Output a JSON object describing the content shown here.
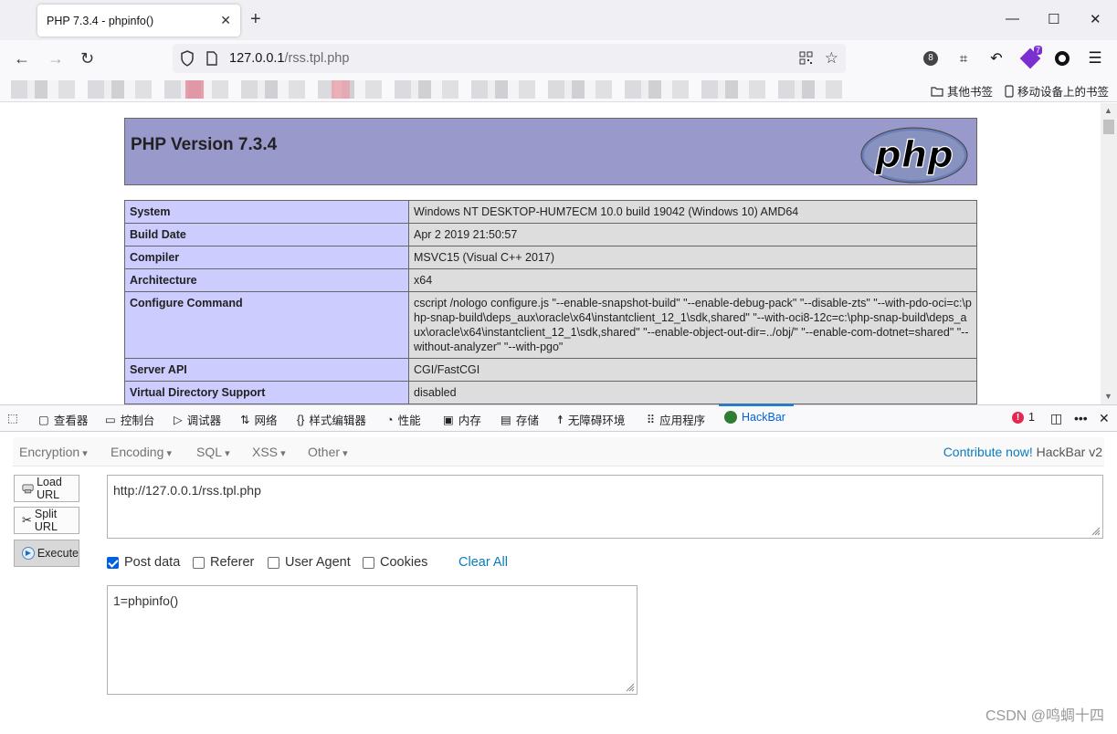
{
  "browser": {
    "tab_title": "PHP 7.3.4 - phpinfo()",
    "url_host": "127.0.0.1",
    "url_path": "/rss.tpl.php",
    "extension_badge": "8",
    "notification_badge": "7",
    "bookmarks": {
      "other": "其他书签",
      "mobile": "移动设备上的书签"
    }
  },
  "phpinfo": {
    "title": "PHP Version 7.3.4",
    "logo_text": "php",
    "rows": [
      {
        "key": "System",
        "value": "Windows NT DESKTOP-HUM7ECM 10.0 build 19042 (Windows 10) AMD64"
      },
      {
        "key": "Build Date",
        "value": "Apr 2 2019 21:50:57"
      },
      {
        "key": "Compiler",
        "value": "MSVC15 (Visual C++ 2017)"
      },
      {
        "key": "Architecture",
        "value": "x64"
      },
      {
        "key": "Configure Command",
        "value": "cscript /nologo configure.js \"--enable-snapshot-build\" \"--enable-debug-pack\" \"--disable-zts\" \"--with-pdo-oci=c:\\php-snap-build\\deps_aux\\oracle\\x64\\instantclient_12_1\\sdk,shared\" \"--with-oci8-12c=c:\\php-snap-build\\deps_aux\\oracle\\x64\\instantclient_12_1\\sdk,shared\" \"--enable-object-out-dir=../obj/\" \"--enable-com-dotnet=shared\" \"--without-analyzer\" \"--with-pgo\""
      },
      {
        "key": "Server API",
        "value": "CGI/FastCGI"
      },
      {
        "key": "Virtual Directory Support",
        "value": "disabled"
      }
    ]
  },
  "devtools": {
    "tabs": [
      "查看器",
      "控制台",
      "调试器",
      "网络",
      "样式编辑器",
      "性能",
      "内存",
      "存储",
      "无障碍环境",
      "应用程序",
      "HackBar"
    ],
    "error_count": "1"
  },
  "hackbar": {
    "menu": [
      "Encryption",
      "Encoding",
      "SQL",
      "XSS",
      "Other"
    ],
    "contribute_link": "Contribute now!",
    "version": "HackBar v2",
    "buttons": {
      "load": "Load URL",
      "split": "Split URL",
      "execute": "Execute"
    },
    "url_value": "http://127.0.0.1/rss.tpl.php",
    "options": {
      "post_data": "Post data",
      "referer": "Referer",
      "user_agent": "User Agent",
      "cookies": "Cookies",
      "clear_all": "Clear All"
    },
    "post_data_checked": true,
    "post_value": "1=phpinfo()"
  },
  "watermark": "CSDN @鸣蜩十四"
}
